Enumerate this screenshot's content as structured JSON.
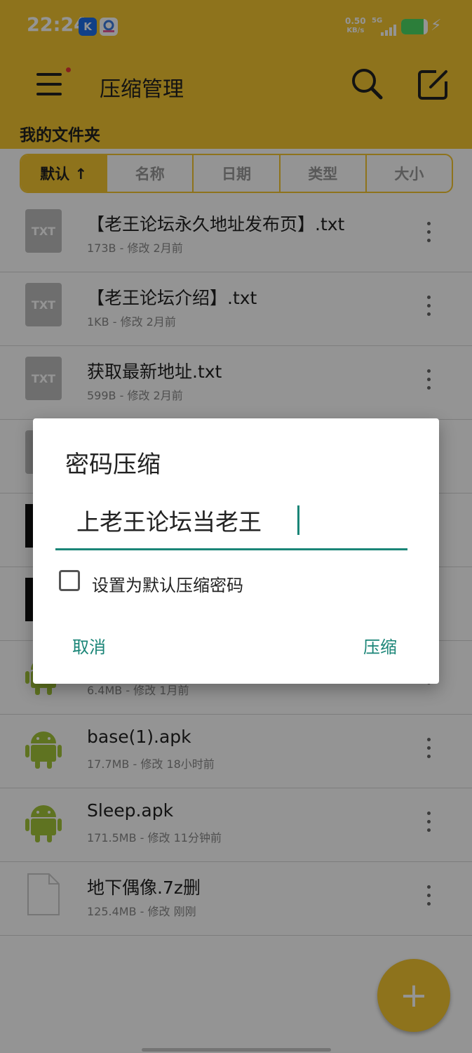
{
  "status_bar": {
    "time": "22:24",
    "net_speed_value": "0.50",
    "net_speed_unit": "KB/s",
    "network": "5G",
    "battery_level": 0.85,
    "battery_color": "#4cd964"
  },
  "app_bar": {
    "title": "压缩管理",
    "menu_icon": "hamburger-menu-icon",
    "search_icon": "search-icon",
    "edit_icon": "edit-icon",
    "accent_color": "#f4c631"
  },
  "folder_label": "我的文件夹",
  "sort_tabs": [
    {
      "label": "默认 ↑",
      "active": true
    },
    {
      "label": "名称",
      "active": false
    },
    {
      "label": "日期",
      "active": false
    },
    {
      "label": "类型",
      "active": false
    },
    {
      "label": "大小",
      "active": false
    }
  ],
  "files": [
    {
      "name": "【老王论坛永久地址发布页】.txt",
      "meta": "173B - 修改 2月前",
      "icon": "txt-file-icon",
      "icon_label": "TXT"
    },
    {
      "name": "【老王论坛介绍】.txt",
      "meta": "1KB - 修改 2月前",
      "icon": "txt-file-icon",
      "icon_label": "TXT"
    },
    {
      "name": "获取最新地址.txt",
      "meta": "599B - 修改 2月前",
      "icon": "txt-file-icon",
      "icon_label": "TXT"
    },
    {
      "name": "",
      "meta": "",
      "icon": "file-icon"
    },
    {
      "name": "",
      "meta": "",
      "icon": "image-file-icon"
    },
    {
      "name": "",
      "meta": "",
      "icon": "image-file-icon"
    },
    {
      "name": "",
      "meta": "6.4MB - 修改 1月前",
      "icon": "android-apk-icon"
    },
    {
      "name": "base(1).apk",
      "meta": "17.7MB - 修改 18小时前",
      "icon": "android-apk-icon"
    },
    {
      "name": "Sleep.apk",
      "meta": "171.5MB - 修改 11分钟前",
      "icon": "android-apk-icon"
    },
    {
      "name": "地下偶像.7z删",
      "meta": "125.4MB - 修改 刚刚",
      "icon": "file-icon"
    }
  ],
  "fab": {
    "label": "+"
  },
  "dialog": {
    "title": "密码压缩",
    "password_value": "上老王论坛当老王",
    "checkbox_label": "设置为默认压缩密码",
    "checkbox_checked": false,
    "cancel_label": "取消",
    "ok_label": "压缩",
    "accent_color": "#1a8577"
  }
}
